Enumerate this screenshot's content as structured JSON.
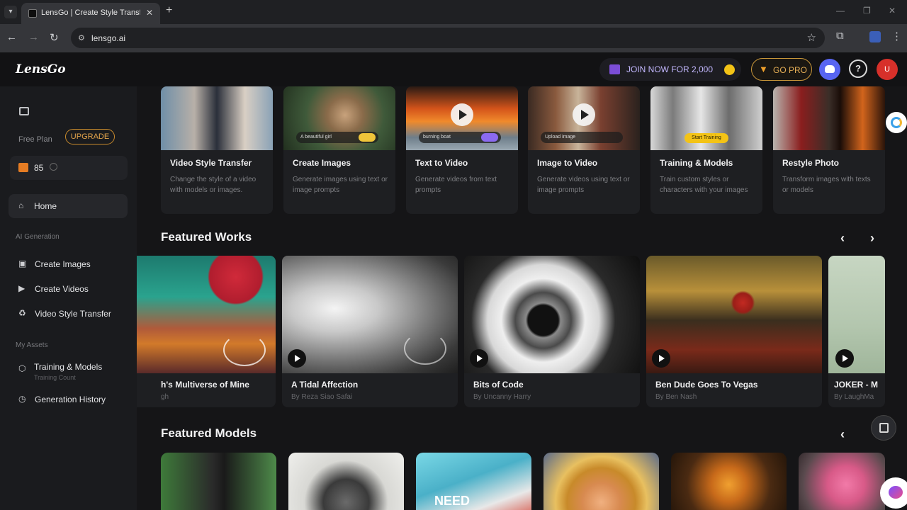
{
  "browser": {
    "tab_title": "LensGo | Create Style Transfer V",
    "url": "lensgo.ai"
  },
  "header": {
    "logo": "LensGo",
    "join_label": "JOIN NOW FOR 2,000",
    "go_pro_label": "GO PRO",
    "help_glyph": "?",
    "avatar_initial": "U"
  },
  "sidebar": {
    "plan_label": "Free Plan",
    "upgrade_label": "UPGRADE",
    "credits": "85",
    "home": "Home",
    "section_generation": "AI Generation",
    "create_images": "Create Images",
    "create_videos": "Create Videos",
    "video_style_transfer": "Video Style Transfer",
    "section_assets": "My Assets",
    "training_models": "Training & Models",
    "training_count": "Training Count",
    "generation_history": "Generation History"
  },
  "tools": [
    {
      "title": "Video Style Transfer",
      "desc": "Change the style of a video with models or images."
    },
    {
      "title": "Create Images",
      "desc": "Generate images using text or image prompts",
      "chip": "A beautiful girl"
    },
    {
      "title": "Text to Video",
      "desc": "Generate videos from text prompts",
      "chip": "burning boat"
    },
    {
      "title": "Image to Video",
      "desc": "Generate videos using text or image prompts",
      "chip": "Upload image"
    },
    {
      "title": "Training & Models",
      "desc": "Train custom styles or characters with your images",
      "chip": "Start Training"
    },
    {
      "title": "Restyle Photo",
      "desc": "Transform images with texts or models"
    }
  ],
  "featured_works": {
    "title": "Featured Works",
    "items": [
      {
        "title": "h's Multiverse of Mine",
        "author": "gh"
      },
      {
        "title": "A Tidal Affection",
        "author": "By Reza Siao Safai"
      },
      {
        "title": "Bits of Code",
        "author": "By Uncanny Harry"
      },
      {
        "title": "Ben Dude Goes To Vegas",
        "author": "By Ben Nash"
      },
      {
        "title": "JOKER - M",
        "author": "By LaughMa"
      }
    ]
  },
  "featured_models": {
    "title": "Featured Models",
    "poster_text": "NEED"
  },
  "colors": {
    "accent_gold": "#f3c316",
    "upgrade_orange": "#e3a44b",
    "discord": "#5865f2",
    "avatar_red": "#d7302a"
  }
}
